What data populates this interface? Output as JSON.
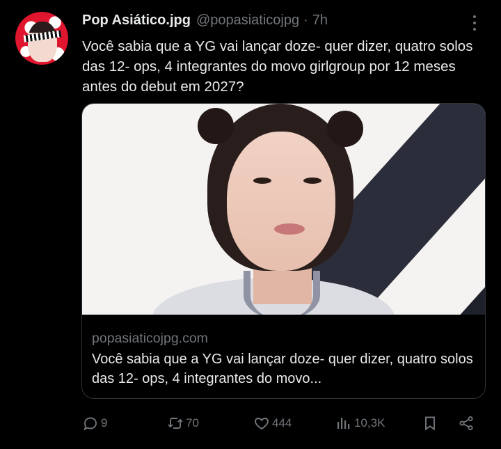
{
  "tweet": {
    "author_name": "Pop Asiático.jpg",
    "handle": "@popasiaticojpg",
    "separator": "·",
    "time": "7h",
    "text": "Você sabia que a YG vai lançar doze- quer dizer, quatro solos das 12- ops, 4 integrantes do movo girlgroup por 12 meses antes do debut em 2027?"
  },
  "card": {
    "domain": "popasiaticojpg.com",
    "title": "Você sabia que a YG vai lançar doze- quer dizer, quatro solos das 12- ops, 4 integrantes do movo..."
  },
  "actions": {
    "replies": "9",
    "retweets": "70",
    "likes": "444",
    "views": "10,3K"
  },
  "icons": {
    "more": "more-vertical-icon",
    "reply": "reply-icon",
    "retweet": "retweet-icon",
    "like": "heart-icon",
    "views": "views-icon",
    "bookmark": "bookmark-icon",
    "share": "share-icon"
  },
  "colors": {
    "background": "#000000",
    "text": "#e7e9ea",
    "muted": "#71767b",
    "border": "#2f3336"
  }
}
